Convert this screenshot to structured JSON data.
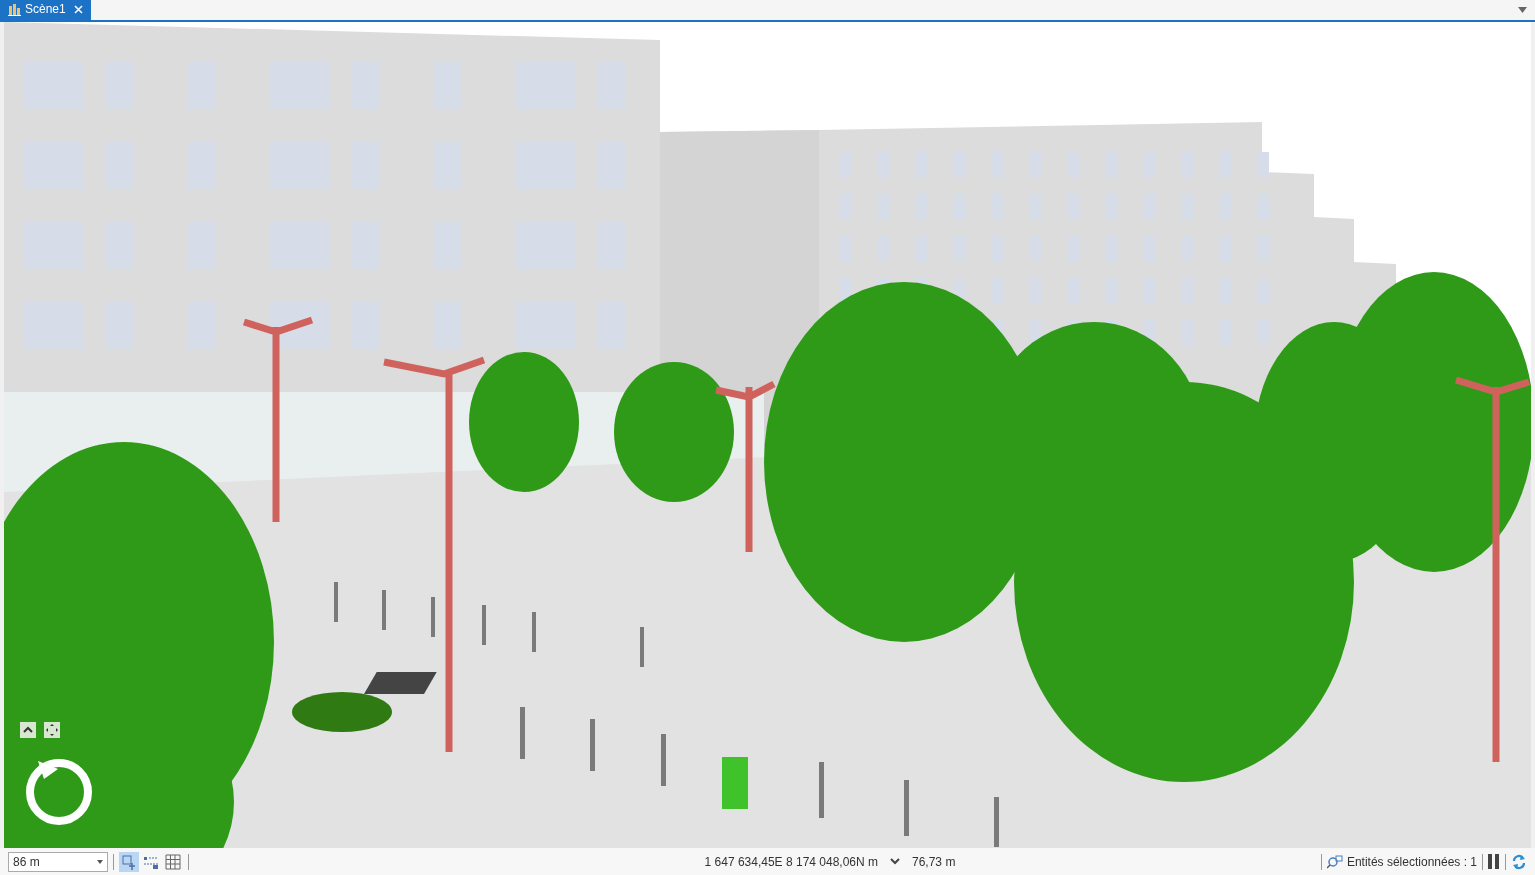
{
  "tab": {
    "title": "Scène1",
    "selected": true
  },
  "status_bar": {
    "scale": "86 m",
    "tools": [
      {
        "kind": "navigate",
        "selected": true
      },
      {
        "kind": "snap",
        "selected": false
      },
      {
        "kind": "grid",
        "selected": false
      }
    ],
    "coordinates": "1 647 634,45E 8 174 048,06N m",
    "elevation": "76,73 m",
    "selection": "Entités sélectionnées : 1"
  }
}
